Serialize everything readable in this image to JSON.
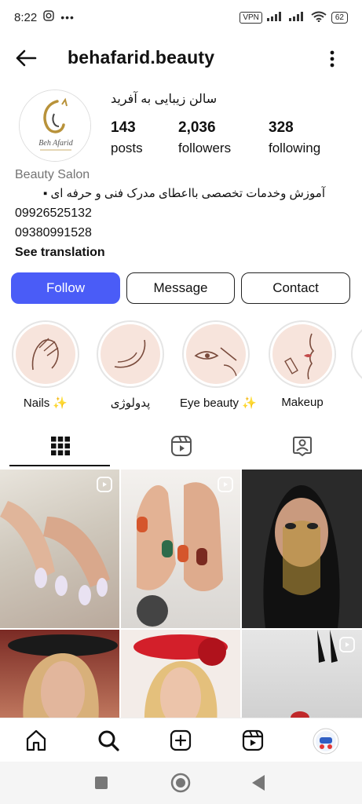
{
  "status": {
    "time": "8:22",
    "vpn": "VPN",
    "battery": "62"
  },
  "header": {
    "username": "behafarid.beauty"
  },
  "profile": {
    "full_name": "سالن زیبایی به آفرید",
    "avatar_text": "Beh Afarid",
    "stats": [
      {
        "value": "143",
        "label": "posts"
      },
      {
        "value": "2,036",
        "label": "followers"
      },
      {
        "value": "328",
        "label": "following"
      }
    ],
    "category": "Beauty Salon",
    "bio_line": "آموزش وخدمات تخصصی بااعطای مدرک فنی و حرفه ای  ▪",
    "phone1": "09926525132",
    "phone2": "09380991528",
    "see_translation": "See translation"
  },
  "buttons": {
    "follow": "Follow",
    "message": "Message",
    "contact": "Contact"
  },
  "highlights": [
    {
      "label": "Nails ✨"
    },
    {
      "label": "پدولوژی"
    },
    {
      "label": "Eye beauty ✨"
    },
    {
      "label": "Makeup"
    }
  ],
  "colors": {
    "accent": "#4a5cf7",
    "highlight_bg": "#f7e4dc"
  }
}
